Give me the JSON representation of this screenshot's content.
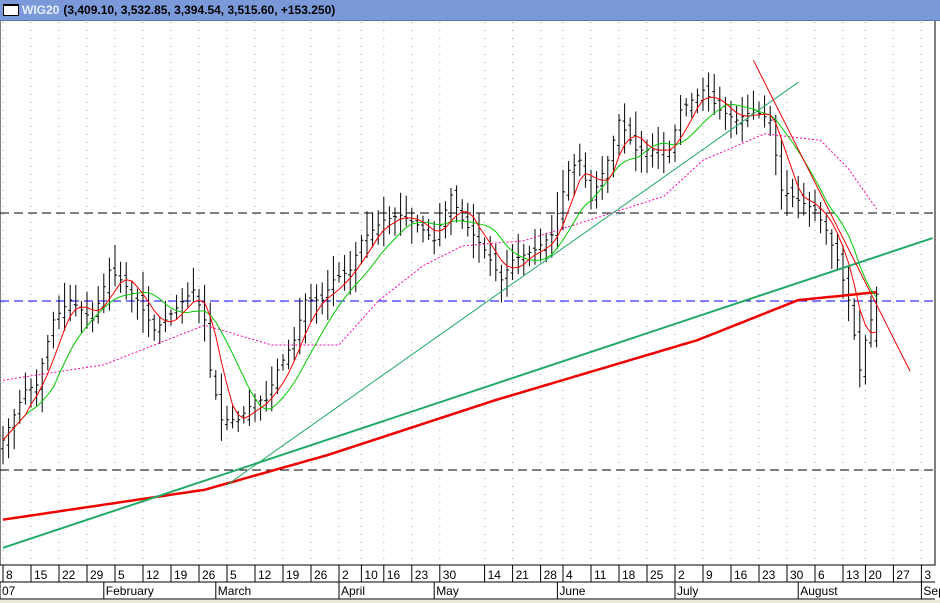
{
  "title": {
    "symbol": "WIG20",
    "values": "(3,409.10, 3,532.85, 3,394.54, 3,515.60, +153.250)"
  },
  "colors": {
    "bars": "#000000",
    "ma_fast": "#ff0000",
    "ma_slow": "#00cc00",
    "ma_mid": "#ff00aa",
    "ma_long": "#ee0000",
    "trend_green": "#22aa66",
    "trend_red": "#ee0000",
    "level_blue": "#0000ff",
    "level_black": "#000000"
  },
  "chart_data": {
    "type": "ohlc",
    "title": "WIG20",
    "close_keypoints": [
      [
        0,
        3184
      ],
      [
        4,
        3298
      ],
      [
        6,
        3309
      ],
      [
        9,
        3457
      ],
      [
        12,
        3502
      ],
      [
        16,
        3457
      ],
      [
        19,
        3570
      ],
      [
        21,
        3548
      ],
      [
        24,
        3502
      ],
      [
        27,
        3434
      ],
      [
        29,
        3457
      ],
      [
        34,
        3525
      ],
      [
        36,
        3457
      ],
      [
        37,
        3343
      ],
      [
        39,
        3230
      ],
      [
        42,
        3230
      ],
      [
        45,
        3275
      ],
      [
        47,
        3275
      ],
      [
        49,
        3343
      ],
      [
        52,
        3411
      ],
      [
        54,
        3502
      ],
      [
        57,
        3502
      ],
      [
        59,
        3548
      ],
      [
        62,
        3570
      ],
      [
        64,
        3638
      ],
      [
        68,
        3684
      ],
      [
        71,
        3695
      ],
      [
        74,
        3673
      ],
      [
        77,
        3638
      ],
      [
        80,
        3741
      ],
      [
        82,
        3684
      ],
      [
        86,
        3616
      ],
      [
        89,
        3548
      ],
      [
        91,
        3593
      ],
      [
        95,
        3616
      ],
      [
        98,
        3650
      ],
      [
        101,
        3797
      ],
      [
        103,
        3820
      ],
      [
        105,
        3729
      ],
      [
        108,
        3820
      ],
      [
        110,
        3911
      ],
      [
        113,
        3843
      ],
      [
        116,
        3843
      ],
      [
        119,
        3843
      ],
      [
        121,
        3934
      ],
      [
        125,
        3979
      ],
      [
        128,
        3934
      ],
      [
        131,
        3911
      ],
      [
        134,
        3934
      ],
      [
        137,
        3911
      ],
      [
        139,
        3752
      ],
      [
        142,
        3729
      ],
      [
        145,
        3707
      ],
      [
        147,
        3661
      ],
      [
        149,
        3593
      ],
      [
        151,
        3502
      ],
      [
        153,
        3343
      ],
      [
        154,
        3411
      ],
      [
        155,
        3457
      ],
      [
        156,
        3515.6
      ]
    ],
    "last_bar": {
      "open": 3409.1,
      "high": 3532.85,
      "low": 3394.54,
      "close": 3515.6,
      "change": 153.25
    },
    "ma_fast_period": 5,
    "ma_slow_period": 10,
    "ma_mid_keypoints": [
      [
        0,
        3320
      ],
      [
        18,
        3355
      ],
      [
        36,
        3445
      ],
      [
        48,
        3400
      ],
      [
        60,
        3400
      ],
      [
        67,
        3500
      ],
      [
        75,
        3580
      ],
      [
        82,
        3625
      ],
      [
        93,
        3637
      ],
      [
        107,
        3693
      ],
      [
        118,
        3738
      ],
      [
        125,
        3820
      ],
      [
        136,
        3880
      ],
      [
        146,
        3865
      ],
      [
        151,
        3800
      ],
      [
        156,
        3709
      ]
    ],
    "ma_long_keypoints": [
      [
        0,
        3003
      ],
      [
        36,
        3071
      ],
      [
        58,
        3150
      ],
      [
        88,
        3275
      ],
      [
        124,
        3411
      ],
      [
        142,
        3502
      ],
      [
        156,
        3520
      ]
    ],
    "trendlines": [
      {
        "color": "trend_green",
        "width": 1,
        "from": [
          40,
          3082
        ],
        "to": [
          142,
          3997
        ]
      },
      {
        "color": "trend_green",
        "width": 2,
        "from": [
          0,
          2939
        ],
        "to": [
          166,
          3643
        ]
      },
      {
        "color": "trend_red",
        "width": 1,
        "from": [
          134,
          4047
        ],
        "to": [
          162,
          3340
        ]
      }
    ],
    "levels": [
      {
        "price": 3700,
        "color": "level_black"
      },
      {
        "price": 3500,
        "color": "level_blue"
      },
      {
        "price": 3116,
        "color": "level_black"
      }
    ],
    "x_ticks": [
      [
        "8",
        0
      ],
      [
        "15",
        5
      ],
      [
        "22",
        10
      ],
      [
        "29",
        15
      ],
      [
        "5",
        20
      ],
      [
        "12",
        25
      ],
      [
        "19",
        30
      ],
      [
        "26",
        35
      ],
      [
        "5",
        40
      ],
      [
        "12",
        45
      ],
      [
        "19",
        50
      ],
      [
        "26",
        55
      ],
      [
        "2",
        60
      ],
      [
        "10",
        64
      ],
      [
        "16",
        68
      ],
      [
        "23",
        73
      ],
      [
        "30",
        78
      ],
      [
        "14",
        86
      ],
      [
        "21",
        91
      ],
      [
        "28",
        96
      ],
      [
        "4",
        100
      ],
      [
        "11",
        105
      ],
      [
        "18",
        110
      ],
      [
        "25",
        115
      ],
      [
        "2",
        120
      ],
      [
        "9",
        125
      ],
      [
        "16",
        130
      ],
      [
        "23",
        135
      ],
      [
        "30",
        140
      ],
      [
        "6",
        145
      ],
      [
        "13",
        150
      ],
      [
        "20",
        154
      ],
      [
        "27",
        159
      ],
      [
        "3",
        164
      ]
    ],
    "months": [
      [
        "07",
        -1
      ],
      [
        "February",
        18
      ],
      [
        "March",
        38
      ],
      [
        "April",
        60
      ],
      [
        "May",
        77
      ],
      [
        "June",
        99
      ],
      [
        "July",
        120
      ],
      [
        "August",
        142
      ],
      [
        "Sep",
        164
      ]
    ]
  }
}
